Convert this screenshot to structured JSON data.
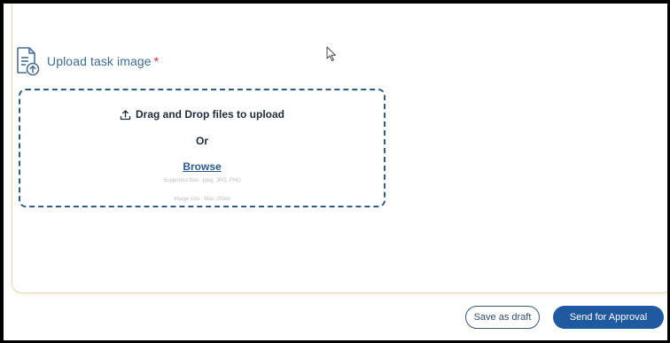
{
  "upload": {
    "title": "Upload task image",
    "required_marker": "*",
    "icons": {
      "header": "document-upload-icon",
      "drag": "upload-arrow-icon"
    }
  },
  "dropzone": {
    "drag_text": "Drag and Drop files to upload",
    "or_text": "Or",
    "browse_label": "Browse",
    "supported_files": "Supported files: Jpeg, JPG, PNG",
    "image_size": "Image size : Max 200kb"
  },
  "actions": {
    "save_draft_label": "Save as draft",
    "send_approval_label": "Send for Approval"
  },
  "colors": {
    "accent": "#1f5aa0",
    "title": "#3c6d94",
    "required": "#d9322f",
    "dashed_border": "#2f5b88",
    "card_border": "#ead9bf"
  }
}
